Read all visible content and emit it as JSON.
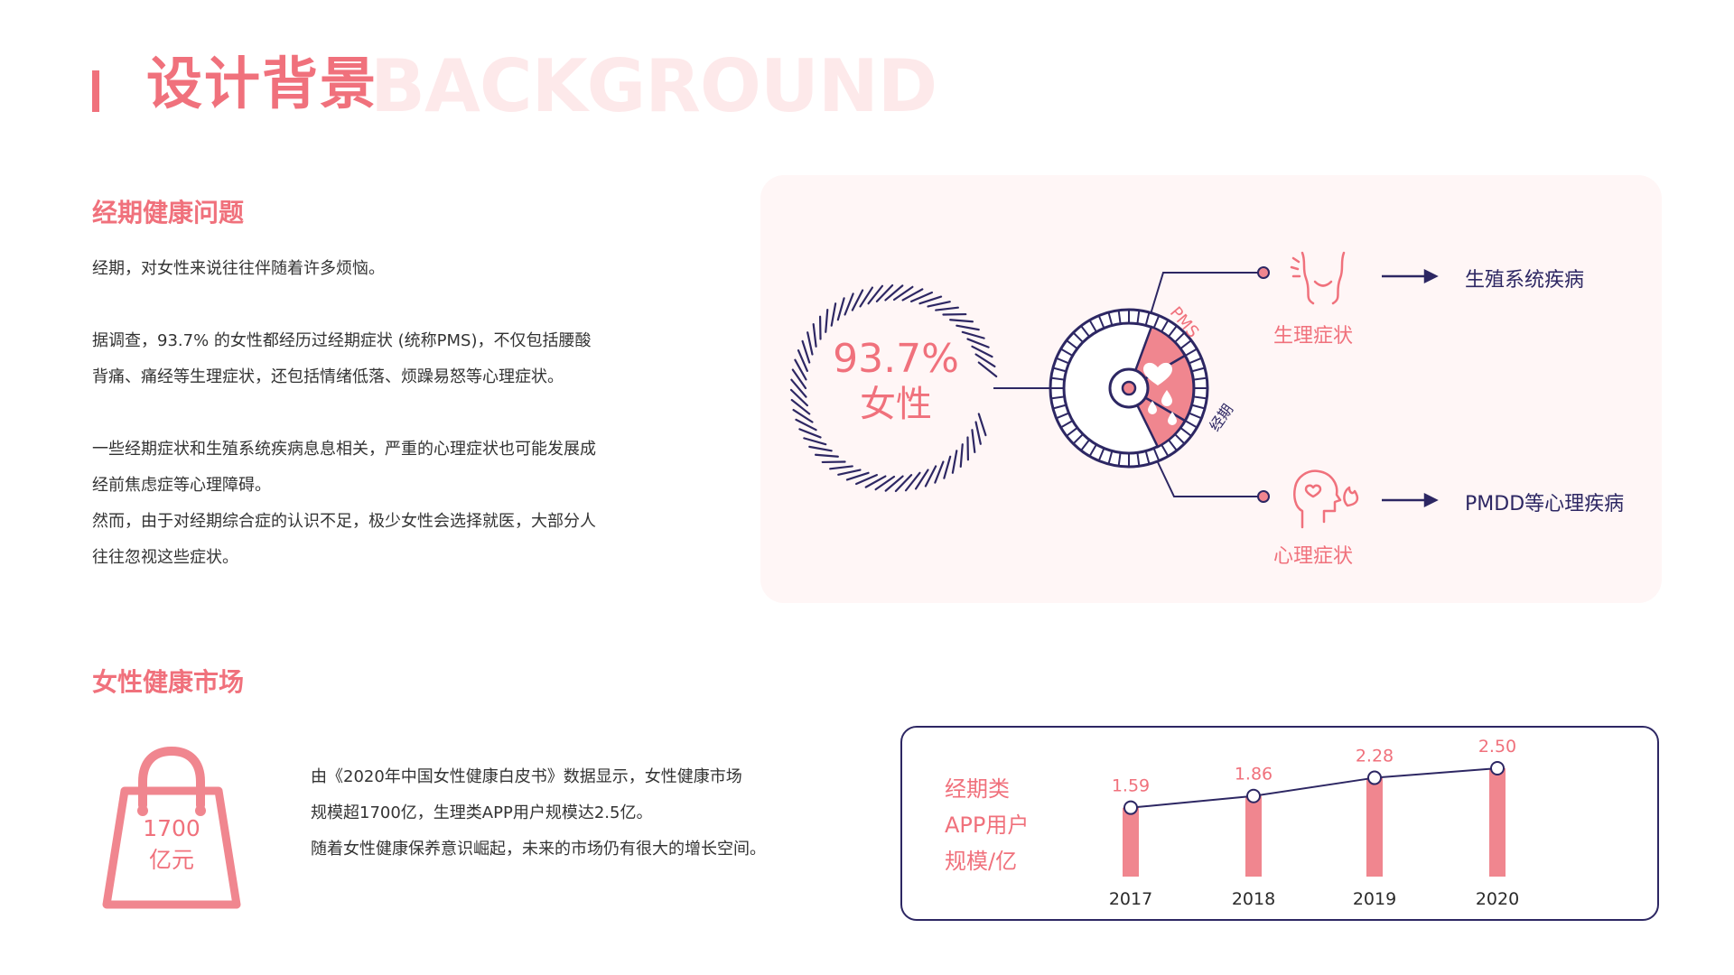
{
  "header": {
    "title": "设计背景",
    "bg_word": "BACKGROUND"
  },
  "sec1": {
    "title": "经期健康问题",
    "lines": [
      "经期，对女性来说往往伴随着许多烦恼。",
      "据调查，93.7% 的女性都经历过经期症状 (统称PMS)，不仅包括腰酸",
      "背痛、痛经等生理症状，还包括情绪低落、烦躁易怒等心理症状。",
      "一些经期症状和生殖系统疾病息息相关，严重的心理症状也可能发展成",
      "经前焦虑症等心理障碍。",
      "然而，由于对经期综合症的认识不足，极少女性会选择就医，大部分人",
      "往往忽视这些症状。"
    ]
  },
  "diagram": {
    "stat_value": "93.7%",
    "stat_label": "女性",
    "pms_label": "PMS",
    "period_label": "经期",
    "physical_label": "生理症状",
    "physical_disease": "生殖系统疾病",
    "mental_label": "心理症状",
    "mental_disease": "PMDD等心理疾病",
    "colors": {
      "accent": "#f0717c",
      "navy": "#2d2763",
      "panel": "#fff6f6"
    }
  },
  "sec2": {
    "title": "女性健康市场",
    "bag_value": "1700",
    "bag_unit": "亿元",
    "lines": [
      "由《2020年中国女性健康白皮书》数据显示，女性健康市场",
      "规模超1700亿，生理类APP用户规模达2.5亿。",
      "随着女性健康保养意识崛起，未来的市场仍有很大的增长空间。"
    ]
  },
  "chart_data": {
    "type": "bar",
    "title_lines": [
      "经期类",
      "APP用户",
      "规模/亿"
    ],
    "categories": [
      "2017",
      "2018",
      "2019",
      "2020"
    ],
    "values": [
      1.59,
      1.86,
      2.28,
      2.5
    ],
    "value_labels": [
      "1.59",
      "1.86",
      "2.28",
      "2.50"
    ],
    "overlay": "line",
    "grid": false,
    "colors": {
      "bar": "#f0868f",
      "line": "#2d2763",
      "label": "#f0717c"
    }
  }
}
